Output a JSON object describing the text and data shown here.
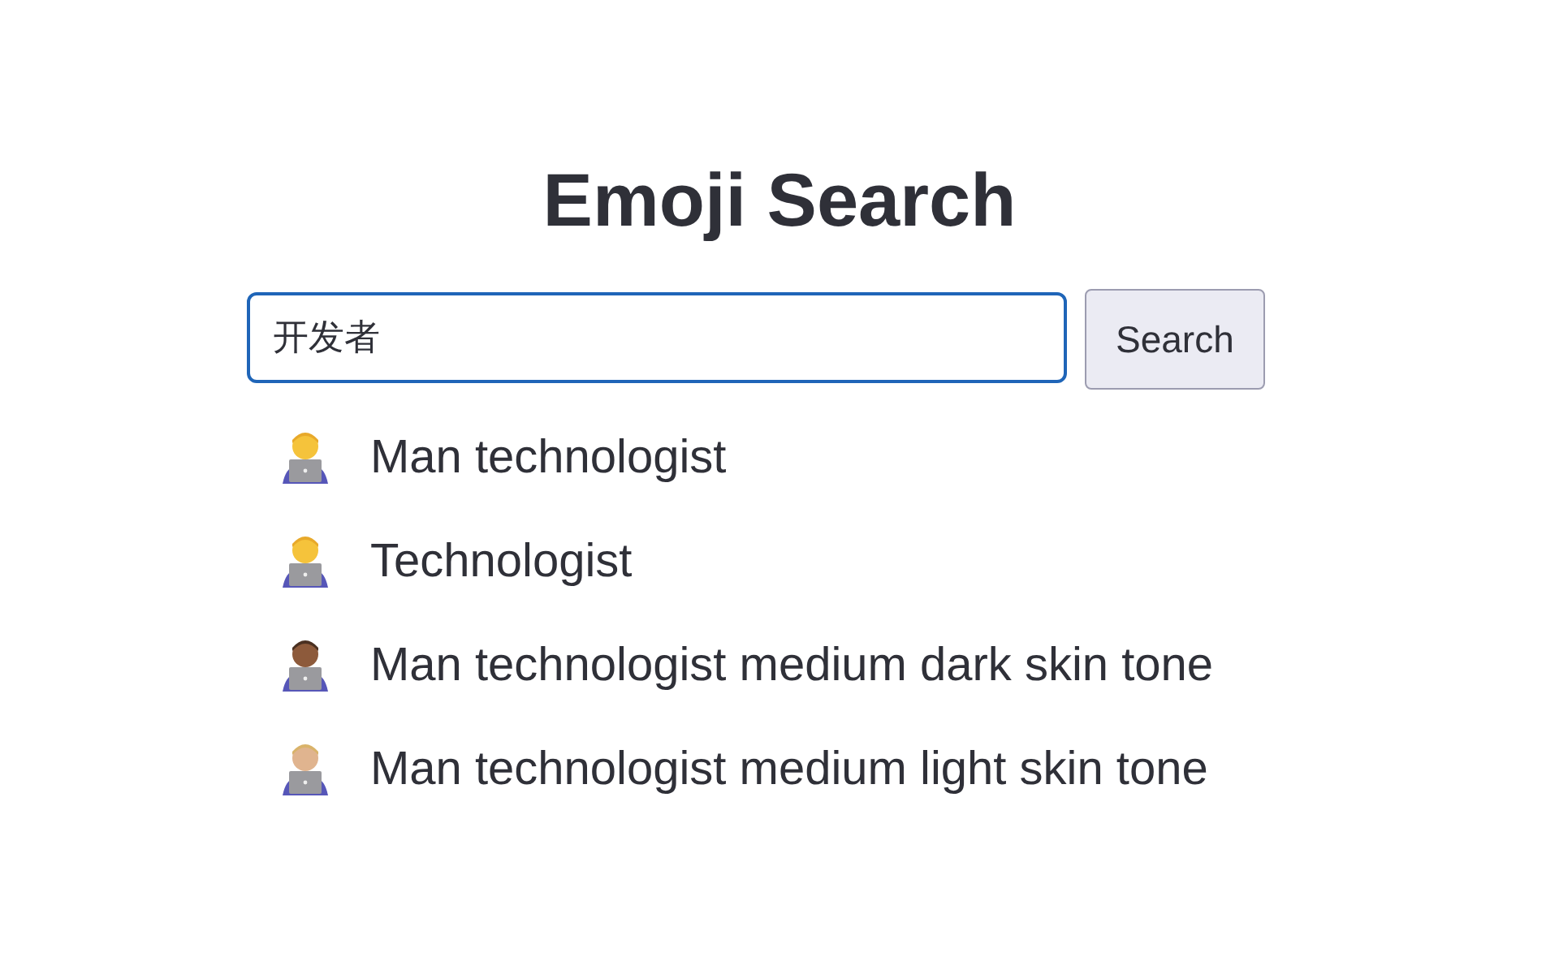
{
  "title": "Emoji Search",
  "search": {
    "value": "开发者",
    "button": "Search"
  },
  "results": [
    {
      "label": "Man technologist",
      "color": "#f5c33b"
    },
    {
      "label": "Technologist",
      "color": "#f5c33b"
    },
    {
      "label": "Man technologist medium dark skin tone",
      "color": "#8d5a3b"
    },
    {
      "label": "Man technologist medium light skin tone",
      "color": "#e0b48f"
    }
  ]
}
